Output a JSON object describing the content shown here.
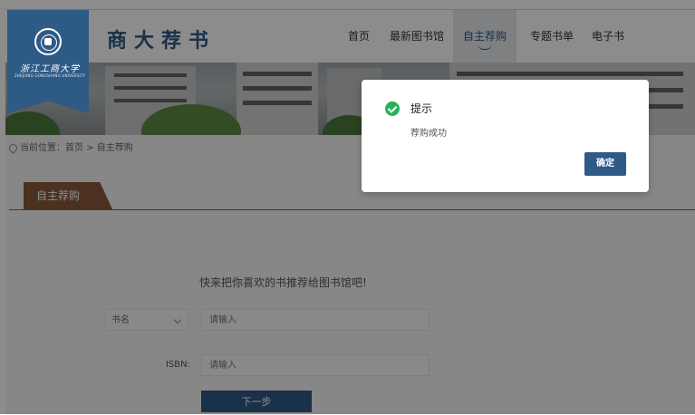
{
  "brand": {
    "site_title": "商大荐书",
    "university_name": "浙江工商大学",
    "university_sub": "ZHEJIANG GONGSHANG UNIVERSITY"
  },
  "nav": [
    {
      "label": "首页"
    },
    {
      "label": "最新图书馆"
    },
    {
      "label": "自主荐购",
      "active": true
    },
    {
      "label": "专题书单"
    },
    {
      "label": "电子书"
    }
  ],
  "breadcrumb": {
    "prefix": "当前位置：",
    "home": "首页",
    "separator": " > ",
    "current": "自主荐购"
  },
  "panel": {
    "tab_label": "自主荐购",
    "lead": "快来把你喜欢的书推荐给图书馆吧!",
    "select_value": "书名",
    "isbn_label": "ISBN:",
    "input_placeholder": "请输入",
    "next_label": "下一步"
  },
  "dialog": {
    "title": "提示",
    "message": "荐购成功",
    "ok_label": "确定"
  },
  "colors": {
    "brand_blue": "#2e5a86",
    "tab_brown": "#8b5a3c",
    "success_green": "#27b15a"
  }
}
